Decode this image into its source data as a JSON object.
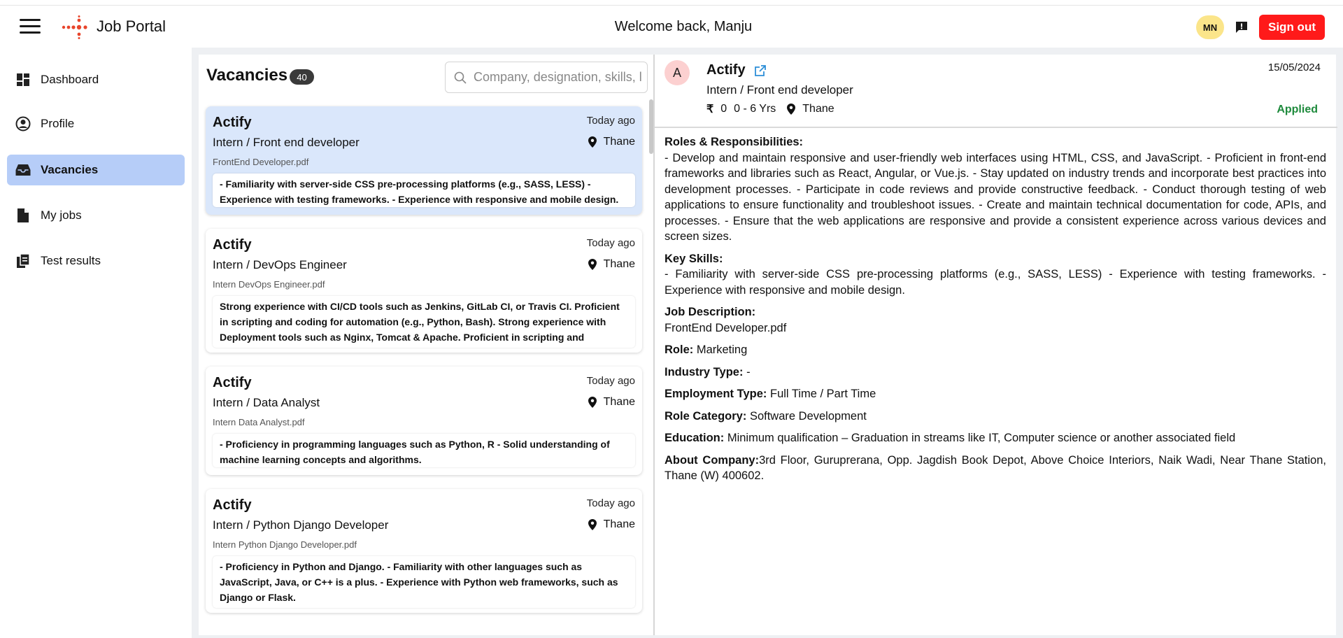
{
  "header": {
    "app_title": "Job Portal",
    "welcome": "Welcome back, Manju",
    "user_initials": "MN",
    "signout_label": "Sign out"
  },
  "sidebar": {
    "items": [
      {
        "label": "Dashboard",
        "icon": "dashboard-icon"
      },
      {
        "label": "Profile",
        "icon": "profile-icon"
      },
      {
        "label": "Vacancies",
        "icon": "inbox-icon",
        "active": true
      },
      {
        "label": "My jobs",
        "icon": "document-icon"
      },
      {
        "label": "Test results",
        "icon": "copy-document-icon"
      }
    ]
  },
  "vacancies": {
    "title": "Vacancies",
    "count": "40",
    "search_placeholder": "Company, designation, skills, l",
    "cards": [
      {
        "company": "Actify",
        "time": "Today ago",
        "role": "Intern / Front end developer",
        "location": "Thane",
        "file": "FrontEnd Developer.pdf",
        "desc": "- Familiarity with server-side CSS pre-processing platforms (e.g., SASS, LESS) - Experience with testing frameworks. - Experience with responsive and mobile design."
      },
      {
        "company": "Actify",
        "time": "Today ago",
        "role": "Intern / DevOps Engineer",
        "location": "Thane",
        "file": "Intern DevOps Engineer.pdf",
        "desc": "Strong experience with CI/CD tools such as Jenkins, GitLab CI, or Travis CI. Proficient in scripting and coding for automation (e.g., Python, Bash). Strong experience with Deployment tools such as Nginx, Tomcat & Apache. Proficient in scripting and coding…"
      },
      {
        "company": "Actify",
        "time": "Today ago",
        "role": "Intern / Data Analyst",
        "location": "Thane",
        "file": "Intern Data Analyst.pdf",
        "desc": "- Proficiency in programming languages such as Python, R - Solid understanding of machine learning concepts and algorithms."
      },
      {
        "company": "Actify",
        "time": "Today ago",
        "role": "Intern / Python Django Developer",
        "location": "Thane",
        "file": "Intern Python Django Developer.pdf",
        "desc": "- Proficiency in Python and Django. - Familiarity with other languages such as JavaScript, Java, or C++ is a plus. - Experience with Python web frameworks, such as Django or Flask."
      }
    ]
  },
  "detail": {
    "avatar_letter": "A",
    "company": "Actify",
    "date": "15/05/2024",
    "role": "Intern / Front end developer",
    "salary": "0",
    "experience": "0 - 6 Yrs",
    "location": "Thane",
    "status": "Applied",
    "roles_label": "Roles & Responsibilities:",
    "roles_text": "- Develop and maintain responsive and user-friendly web interfaces using HTML, CSS, and JavaScript. - Proficient in front-end frameworks and libraries such as React, Angular, or Vue.js. - Stay updated on industry trends and incorporate best practices into development processes. - Participate in code reviews and provide constructive feedback. - Conduct thorough testing of web applications to ensure functionality and troubleshoot issues. - Create and maintain technical documentation for code, APIs, and processes. - Ensure that the web applications are responsive and provide a consistent experience across various devices and screen sizes.",
    "skills_label": "Key Skills:",
    "skills_text": "- Familiarity with server-side CSS pre-processing platforms (e.g., SASS, LESS) - Experience with testing frameworks. - Experience with responsive and mobile design.",
    "jd_label": "Job Description:",
    "jd_text": "FrontEnd Developer.pdf",
    "role_label": "Role:",
    "role_value": "Marketing",
    "industry_label": "Industry Type:",
    "industry_value": "-",
    "employment_label": "Employment Type:",
    "employment_value": "Full Time / Part Time",
    "category_label": "Role Category:",
    "category_value": "Software Development",
    "education_label": "Education:",
    "education_value": "Minimum qualification – Graduation in streams like IT, Computer science or another associated field",
    "about_label": "About Company:",
    "about_value": "3rd Floor, Guruprerana, Opp. Jagdish Book Depot, Above Choice Interiors, Naik Wadi, Near Thane Station, Thane (W) 400602."
  },
  "colors": {
    "accent_red": "#ff1a1a",
    "active_nav": "#b6cdf8",
    "selected_card": "#dae7fb",
    "applied_green": "#1e8a3c",
    "avatar_yellow": "#fbe58a"
  }
}
